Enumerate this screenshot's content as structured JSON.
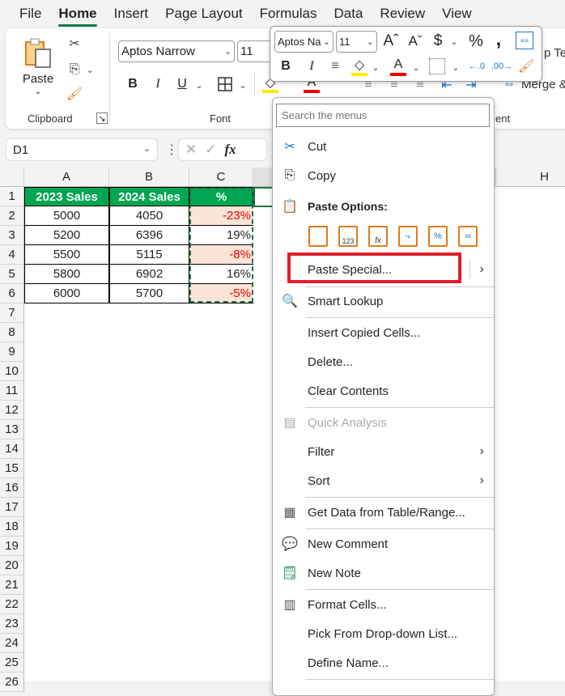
{
  "ribbon_tabs": [
    "File",
    "Home",
    "Insert",
    "Page Layout",
    "Formulas",
    "Data",
    "Review",
    "View"
  ],
  "active_tab": "Home",
  "clipboard": {
    "paste_label": "Paste",
    "group_label": "Clipboard"
  },
  "font": {
    "name": "Aptos Narrow",
    "size": "11",
    "group_label": "Font",
    "bold": "B",
    "italic": "I",
    "underline": "U"
  },
  "alignment": {
    "wrap_text_partial": "p Te",
    "merge_partial": "Merge &",
    "group_label_partial": "ent"
  },
  "mini_toolbar": {
    "font_name": "Aptos Na",
    "font_size": "11"
  },
  "name_box": "D1",
  "formula_bar": {
    "fx": "fx"
  },
  "columns": [
    "A",
    "B",
    "C",
    "H"
  ],
  "rows": [
    "1",
    "2",
    "3",
    "4",
    "5",
    "6",
    "7",
    "8",
    "9",
    "10",
    "11",
    "12",
    "13",
    "14",
    "15",
    "16",
    "17",
    "18",
    "19",
    "20",
    "21",
    "22",
    "23",
    "24",
    "25",
    "26"
  ],
  "table": {
    "headers": [
      "2023 Sales",
      "2024 Sales",
      "% Change"
    ],
    "rows": [
      {
        "a": "5000",
        "b": "4050",
        "c": "-23%",
        "neg": true
      },
      {
        "a": "5200",
        "b": "6396",
        "c": "19%",
        "neg": false
      },
      {
        "a": "5500",
        "b": "5115",
        "c": "-8%",
        "neg": true
      },
      {
        "a": "5800",
        "b": "6902",
        "c": "16%",
        "neg": false
      },
      {
        "a": "6000",
        "b": "5700",
        "c": "-5%",
        "neg": true
      }
    ]
  },
  "context_menu": {
    "search_placeholder": "Search the menus",
    "cut": "Cut",
    "copy": "Copy",
    "paste_options": "Paste Options:",
    "paste_special": "Paste Special...",
    "smart_lookup": "Smart Lookup",
    "insert_copied_cells": "Insert Copied Cells...",
    "delete": "Delete...",
    "clear_contents": "Clear Contents",
    "quick_analysis": "Quick Analysis",
    "filter": "Filter",
    "sort": "Sort",
    "get_data": "Get Data from Table/Range...",
    "new_comment": "New Comment",
    "new_note": "New Note",
    "format_cells": "Format Cells...",
    "pick_dropdown": "Pick From Drop-down List...",
    "define_name": "Define Name..."
  },
  "colors": {
    "header_green": "#00a651",
    "negative_fill": "#fce4d6",
    "negative_text": "#ee0000",
    "highlight_box": "#e01e2b",
    "accent": "#107c41"
  }
}
